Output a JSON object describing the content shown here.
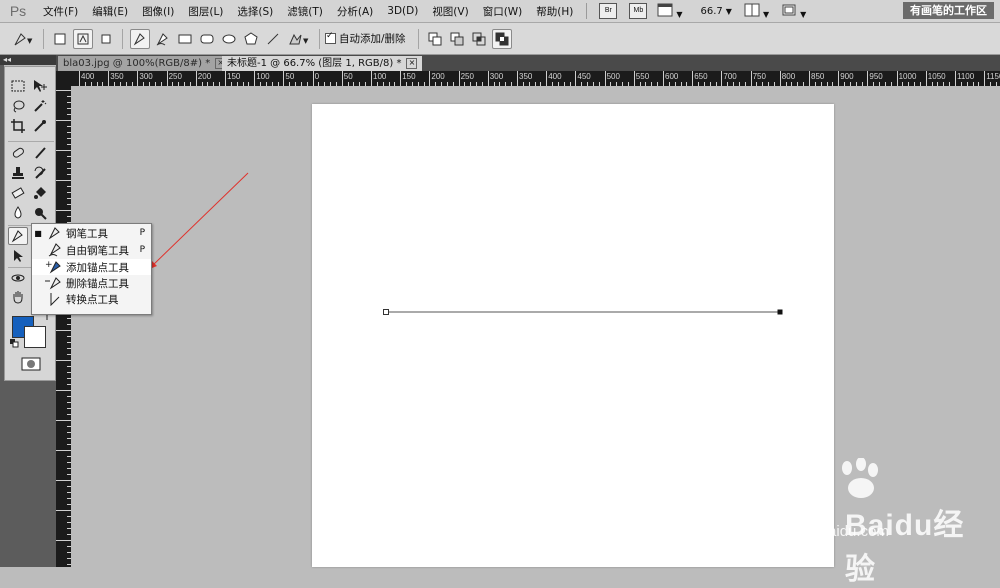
{
  "app": {
    "logo": "Ps",
    "workspace": "有画笔的工作区"
  },
  "menu": [
    "文件(F)",
    "编辑(E)",
    "图像(I)",
    "图层(L)",
    "选择(S)",
    "滤镜(T)",
    "分析(A)",
    "3D(D)",
    "视图(V)",
    "窗口(W)",
    "帮助(H)"
  ],
  "menubar_icons": {
    "bridge": "Br",
    "mini_bridge": "Mb",
    "zoom": "66.7"
  },
  "options": {
    "auto_add_delete": "自动添加/删除",
    "auto_add_delete_checked": true
  },
  "tabs": [
    {
      "label": "bla03.jpg @ 100%(RGB/8#) *",
      "active": false
    },
    {
      "label": "未标题-1 @ 66.7% (图层 1, RGB/8) *",
      "active": true
    }
  ],
  "ruler_labels": [
    "400",
    "350",
    "300",
    "250",
    "200",
    "150",
    "100",
    "50",
    "0",
    "50",
    "100",
    "150",
    "200",
    "250",
    "300",
    "350",
    "400",
    "450",
    "500",
    "550",
    "600",
    "650",
    "700",
    "750",
    "800",
    "850",
    "900",
    "950",
    "1000",
    "1050",
    "1100",
    "1150"
  ],
  "flyout": [
    {
      "label": "钢笔工具",
      "key": "P",
      "selected": true,
      "icon": "pen-icon"
    },
    {
      "label": "自由钢笔工具",
      "key": "P",
      "selected": false,
      "icon": "freeform-pen-icon"
    },
    {
      "label": "添加锚点工具",
      "key": "",
      "selected": false,
      "icon": "add-anchor-icon",
      "highlighted": true
    },
    {
      "label": "删除锚点工具",
      "key": "",
      "selected": false,
      "icon": "delete-anchor-icon"
    },
    {
      "label": "转换点工具",
      "key": "",
      "selected": false,
      "icon": "convert-point-icon"
    }
  ],
  "colors": {
    "foreground": "#1560bd",
    "background": "#ffffff",
    "arrow": "#e0322c"
  },
  "watermark": {
    "logo": "Baidu经验",
    "url": "jingyan.baidu.com"
  }
}
